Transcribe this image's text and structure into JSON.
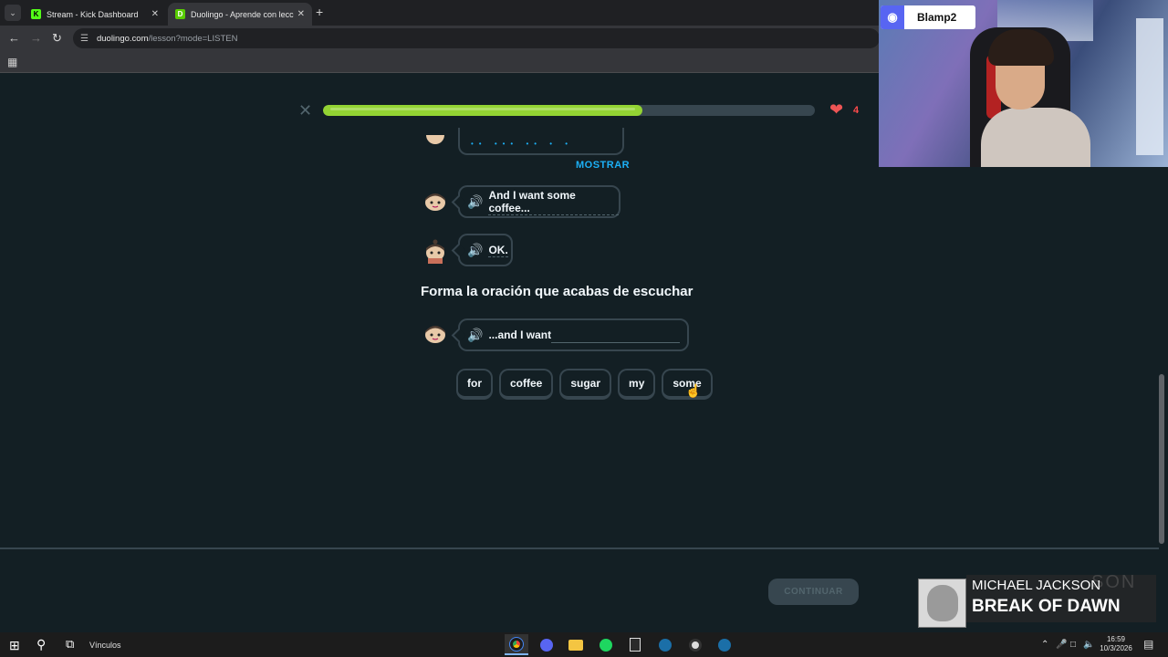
{
  "browser": {
    "tabs": [
      {
        "title": "Stream - Kick Dashboard",
        "favicon": "K",
        "active": false
      },
      {
        "title": "Duolingo - Aprende con leccio",
        "favicon": "D",
        "active": true
      }
    ],
    "url_host": "duolingo.com",
    "url_path": "/lesson?mode=LISTEN"
  },
  "lesson": {
    "hearts": "4",
    "progress": 0.65,
    "mostrar_label": "MOSTRAR",
    "messages": [
      {
        "text": "And I want some coffee..."
      },
      {
        "text": "OK."
      }
    ],
    "question": "Forma la oración que acabas de escuchar",
    "answer_prompt": "...and I want",
    "word_bank": [
      "for",
      "coffee",
      "sugar",
      "my",
      "some"
    ],
    "continue_label": "CONTINUAR"
  },
  "stream_overlay": {
    "discord_name": "Blamp2",
    "now_playing_artist": "MICHAEL JACKSON",
    "now_playing_ghost": "SON",
    "now_playing_title": "BREAK OF DAWN"
  },
  "taskbar": {
    "label": "Vínculos",
    "time": "16:59",
    "date": "10/3/2026"
  }
}
